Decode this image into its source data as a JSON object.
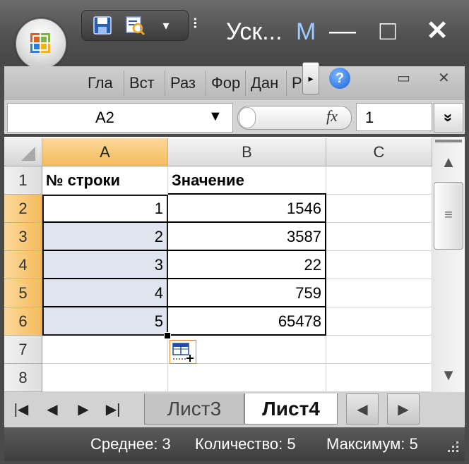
{
  "title_bar": {
    "title": "Уск...",
    "title_suffix": "M",
    "minimize_glyph": "—",
    "maximize_glyph": "□",
    "close_glyph": "✕",
    "qat_overflow_glyph": "⠇"
  },
  "ribbon": {
    "tabs": [
      "Гла",
      "Вст",
      "Раз",
      "Фор",
      "Дан",
      "Р"
    ],
    "scroll_glyph": "▸",
    "help_glyph": "?",
    "doc_restore_glyph": "▭",
    "doc_close_glyph": "✕"
  },
  "formula_bar": {
    "name_box": "A2",
    "dropdown_glyph": "▼",
    "fx_label": "fx",
    "value": "1",
    "expand_glyph": "»"
  },
  "sheet": {
    "columns": [
      "A",
      "B",
      "C"
    ],
    "rows": [
      "1",
      "2",
      "3",
      "4",
      "5",
      "6",
      "7",
      "8"
    ],
    "headers": {
      "a1": "№ строки",
      "b1": "Значение"
    },
    "data": [
      {
        "row": "2",
        "a": "1",
        "b": "1546"
      },
      {
        "row": "3",
        "a": "2",
        "b": "3587"
      },
      {
        "row": "4",
        "a": "3",
        "b": "22"
      },
      {
        "row": "5",
        "a": "4",
        "b": "759"
      },
      {
        "row": "6",
        "a": "5",
        "b": "65478"
      }
    ],
    "active_cell": "A2",
    "selection": "A2:A6"
  },
  "scrollbar": {
    "up_glyph": "▲",
    "down_glyph": "▼",
    "thumb_glyph": "≡"
  },
  "sheet_tabs": {
    "nav": [
      "|◀",
      "◀",
      "▶",
      "▶|"
    ],
    "tabs": [
      "Лист3",
      "Лист4"
    ],
    "active": "Лист4",
    "h_left_glyph": "◀",
    "h_right_glyph": "▶"
  },
  "status_bar": {
    "average": "Среднее: 3",
    "count": "Количество: 5",
    "maximum": "Максимум: 5"
  },
  "colors": {
    "selected_header": "#f5bb5a",
    "selection_fill": "#dfe4ee",
    "chrome_dark": "#4a4a4a",
    "help_blue": "#1660d4"
  }
}
